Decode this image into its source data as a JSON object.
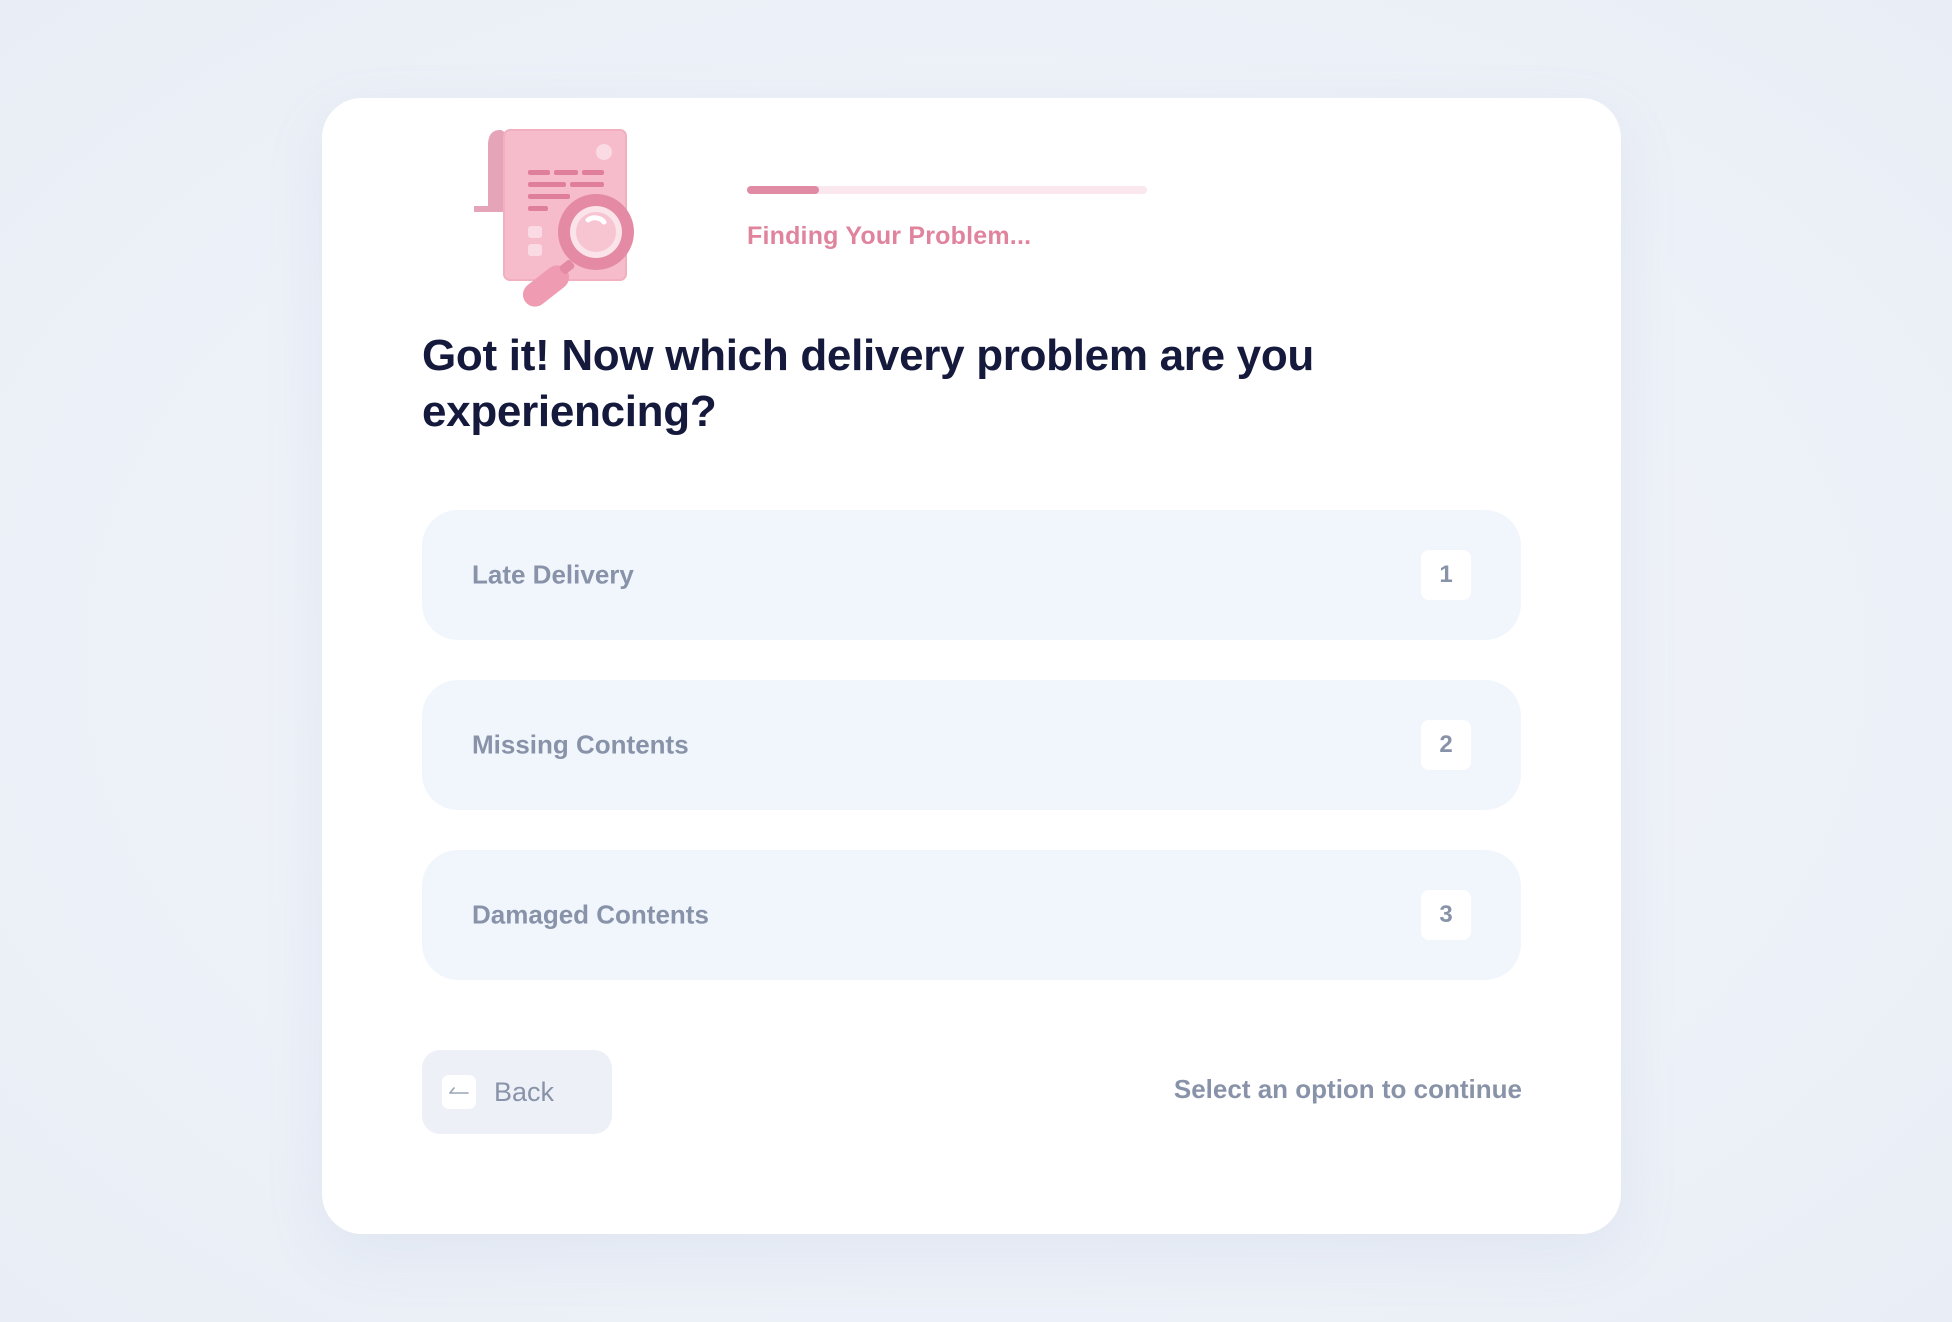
{
  "progress": {
    "status_text": "Finding Your Problem...",
    "percent": 18
  },
  "question": {
    "title": "Got it! Now which delivery problem are you experiencing?"
  },
  "options": [
    {
      "label": "Late Delivery",
      "key": "1"
    },
    {
      "label": "Missing Contents",
      "key": "2"
    },
    {
      "label": "Damaged Contents",
      "key": "3"
    }
  ],
  "footer": {
    "back_label": "Back",
    "back_icon": "arrow-left-icon",
    "hint": "Select an option to continue"
  },
  "colors": {
    "accent": "#e08aa3",
    "heading": "#151a3d",
    "muted": "#8893a9",
    "option_bg": "#f1f6fd"
  },
  "illustration": {
    "icon": "document-magnifier-icon"
  }
}
